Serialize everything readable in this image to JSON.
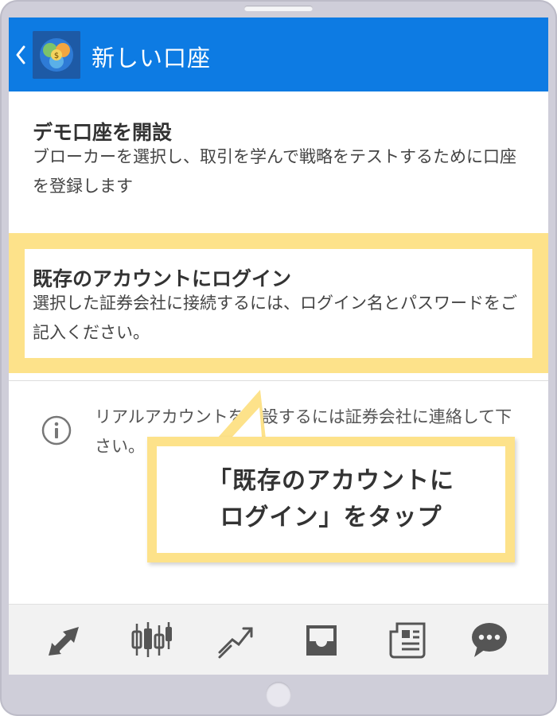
{
  "header": {
    "title": "新しい口座",
    "back_icon": "chevron-left-icon",
    "logo": "metatrader-logo"
  },
  "demo_account": {
    "title": "デモ口座を開設",
    "description": "ブローカーを選択し、取引を学んで戦略をテストするために口座を登録します"
  },
  "existing_account": {
    "title": "既存のアカウントにログイン",
    "description": "選択した証券会社に接続するには、ログイン名とパスワードをご記入ください。"
  },
  "info": {
    "icon": "info-icon",
    "text": "リアルアカウントを開設するには証券会社に連絡して下さい。"
  },
  "callout": {
    "text": "「既存のアカウントに\nログイン」をタップ"
  },
  "tabs": [
    {
      "name": "quotes-icon"
    },
    {
      "name": "chart-icon"
    },
    {
      "name": "trade-icon"
    },
    {
      "name": "history-icon"
    },
    {
      "name": "news-icon"
    },
    {
      "name": "chat-icon"
    }
  ],
  "colors": {
    "header": "#0d7be3",
    "highlight": "#fde28a",
    "tab_icon": "#555555"
  }
}
